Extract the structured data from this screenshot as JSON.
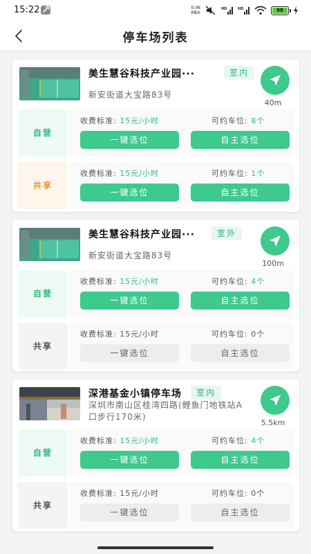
{
  "status_bar": {
    "time": "15:22",
    "net_speed_value": "0.06",
    "net_speed_unit": "KB/s",
    "battery": "98",
    "icons": [
      "wrench-icon",
      "mute-icon",
      "hd-signal-icon",
      "hd-signal-icon",
      "wifi-icon",
      "battery-icon",
      "charging-icon"
    ]
  },
  "header": {
    "title": "停车场列表",
    "back_icon": "chevron-left-icon"
  },
  "colors": {
    "accent": "#3ec98d",
    "accent_text": "#2fb884",
    "share_orange": "#e8963a",
    "disabled_bg": "#ededed"
  },
  "lots": [
    {
      "name": "美生慧谷科技产业园···",
      "type": "室内",
      "address": "新安街道大宝路83号",
      "distance": "40m",
      "rows": [
        {
          "tag": "自营",
          "fee_label": "收费标准:",
          "fee_value": "15元/小时",
          "spots_label": "可约车位:",
          "spots_value": "8个",
          "btn_quick": "一键选位",
          "btn_self": "自主选位",
          "active": true
        },
        {
          "tag": "共享",
          "fee_label": "收费标准:",
          "fee_value": "15元/小时",
          "spots_label": "可约车位:",
          "spots_value": "1个",
          "btn_quick": "一键选位",
          "btn_self": "自主选位",
          "active": true
        }
      ]
    },
    {
      "name": "美生慧谷科技产业园···",
      "type": "室外",
      "address": "新安街道大宝路83号",
      "distance": "100m",
      "rows": [
        {
          "tag": "自营",
          "fee_label": "收费标准:",
          "fee_value": "15元/小时",
          "spots_label": "可约车位:",
          "spots_value": "4个",
          "btn_quick": "一键选位",
          "btn_self": "自主选位",
          "active": true
        },
        {
          "tag": "共享",
          "fee_label": "收费标准:",
          "fee_value": "15元/小时",
          "spots_label": "可约车位:",
          "spots_value": "0个",
          "btn_quick": "一键选位",
          "btn_self": "自主选位",
          "active": false
        }
      ]
    },
    {
      "name": "深港基金小镇停车场",
      "type": "室内",
      "address": "深圳市南山区桂湾四路(鲤鱼门地铁站A口步行170米)",
      "distance": "5.5km",
      "rows": [
        {
          "tag": "自营",
          "fee_label": "收费标准:",
          "fee_value": "15元/小时",
          "spots_label": "可约车位:",
          "spots_value": "4个",
          "btn_quick": "一键选位",
          "btn_self": "自主选位",
          "active": true
        },
        {
          "tag": "共享",
          "fee_label": "收费标准:",
          "fee_value": "15元/小时",
          "spots_label": "可约车位:",
          "spots_value": "0个",
          "btn_quick": "一键选位",
          "btn_self": "自主选位",
          "active": false
        }
      ]
    }
  ]
}
